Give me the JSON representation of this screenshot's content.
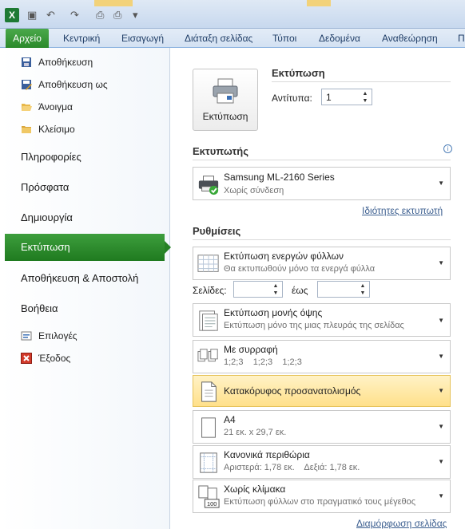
{
  "ribbon": {
    "tabs": [
      "Αρχείο",
      "Κεντρική",
      "Εισαγωγή",
      "Διάταξη σελίδας",
      "Τύποι",
      "Δεδομένα",
      "Αναθεώρηση",
      "Π"
    ]
  },
  "nav": {
    "save": "Αποθήκευση",
    "save_as": "Αποθήκευση ως",
    "open": "Άνοιγμα",
    "close": "Κλείσιμο",
    "info": "Πληροφορίες",
    "recent": "Πρόσφατα",
    "new": "Δημιουργία",
    "print": "Εκτύπωση",
    "save_send": "Αποθήκευση & Αποστολή",
    "help": "Βοήθεια",
    "options": "Επιλογές",
    "exit": "Έξοδος"
  },
  "print": {
    "heading": "Εκτύπωση",
    "button_label": "Εκτύπωση",
    "copies_label": "Αντίτυπα:",
    "copies_value": "1"
  },
  "printer": {
    "heading": "Εκτυπωτής",
    "name": "Samsung ML-2160 Series",
    "status": "Χωρίς σύνδεση",
    "properties_link": "Ιδιότητες εκτυπωτή"
  },
  "settings": {
    "heading": "Ρυθμίσεις",
    "what": {
      "title": "Εκτύπωση ενεργών φύλλων",
      "sub": "Θα εκτυπωθούν μόνο τα ενεργά φύλλα"
    },
    "pages_label": "Σελίδες:",
    "to_label": "έως",
    "sides": {
      "title": "Εκτύπωση μονής όψης",
      "sub": "Εκτύπωση μόνο της μιας πλευράς της σελίδας"
    },
    "collate": {
      "title": "Με συρραφή",
      "sub": "1;2;3    1;2;3    1;2;3"
    },
    "orientation": {
      "title": "Κατακόρυφος προσανατολισμός"
    },
    "paper": {
      "title": "A4",
      "sub": "21 εκ. x 29,7 εκ."
    },
    "margins": {
      "title": "Κανονικά περιθώρια",
      "sub": "Αριστερά: 1,78 εκ.    Δεξιά: 1,78 εκ."
    },
    "scaling": {
      "title": "Χωρίς κλίμακα",
      "sub": "Εκτύπωση φύλλων στο πραγματικό τους μέγεθος"
    },
    "page_setup_link": "Διαμόρφωση σελίδας"
  }
}
